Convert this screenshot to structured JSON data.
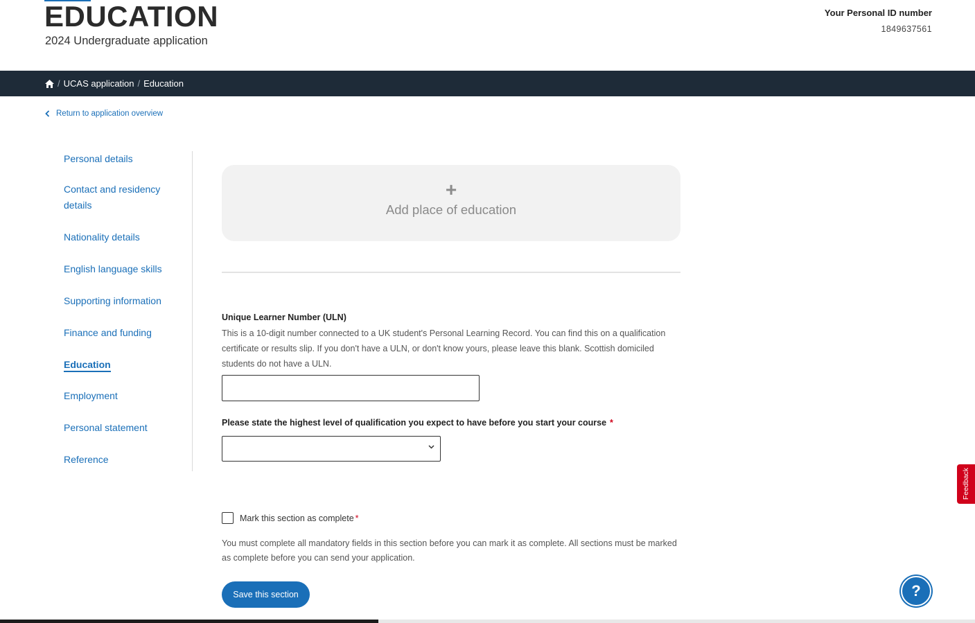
{
  "header": {
    "title": "EDUCATION",
    "subtitle": "2024 Undergraduate application",
    "personal_id_label": "Your Personal ID number",
    "personal_id_value": "1849637561"
  },
  "breadcrumb": {
    "items": [
      "UCAS application",
      "Education"
    ]
  },
  "back_link": "Return to application overview",
  "sidebar": {
    "items": [
      {
        "label": "Personal details"
      },
      {
        "label": "Contact and residency details"
      },
      {
        "label": "Nationality details"
      },
      {
        "label": "English language skills"
      },
      {
        "label": "Supporting information"
      },
      {
        "label": "Finance and funding"
      },
      {
        "label": "Education",
        "active": true
      },
      {
        "label": "Employment"
      },
      {
        "label": "Personal statement"
      },
      {
        "label": "Reference"
      }
    ]
  },
  "add_place": {
    "plus": "+",
    "label": "Add place of education"
  },
  "uln": {
    "label": "Unique Learner Number (ULN)",
    "help": "This is a 10-digit number connected to a UK student's Personal Learning Record. You can find this on a qualification certificate or results slip. If you don't have a ULN, or don't know yours, please leave this blank. Scottish domiciled students do not have a ULN.",
    "value": ""
  },
  "qualification": {
    "label": "Please state the highest level of qualification you expect to have before you start your course",
    "required_mark": "*",
    "selected": ""
  },
  "complete": {
    "label": "Mark this section as complete",
    "required_mark": "*",
    "checked": false,
    "help": "You must complete all mandatory fields in this section before you can mark it as complete. All sections must be marked as complete before you can send your application."
  },
  "save_button": "Save this section",
  "feedback_tab": "Feedback",
  "help_button": "?",
  "icons": {
    "home": "home-icon",
    "back": "chevron-left-icon",
    "select": "chevron-down-icon",
    "add": "plus-icon"
  },
  "colors": {
    "accent": "#1a6fb8",
    "breadcrumb_bg": "#1e2b38",
    "required": "#d0021b",
    "feedback": "#d0021b"
  }
}
